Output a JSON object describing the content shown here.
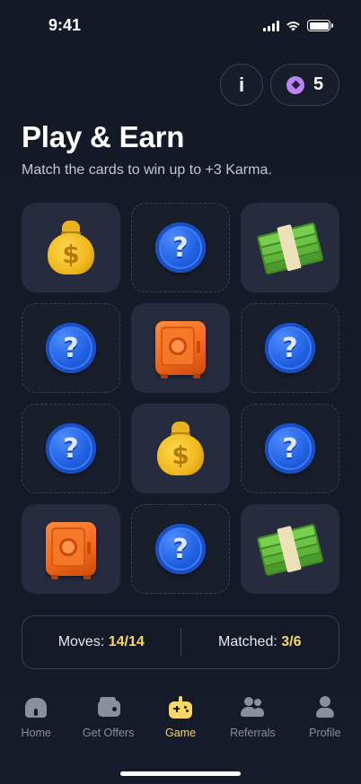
{
  "status_bar": {
    "time": "9:41"
  },
  "header": {
    "info_label": "i",
    "karma_count": "5"
  },
  "title": "Play & Earn",
  "subtitle": "Match the cards to win up to +3 Karma.",
  "grid": {
    "cards": [
      {
        "content": "money-bag",
        "state": "revealed"
      },
      {
        "content": "question-coin",
        "state": "hidden"
      },
      {
        "content": "cash-stack",
        "state": "revealed"
      },
      {
        "content": "question-coin",
        "state": "hidden"
      },
      {
        "content": "safe",
        "state": "revealed"
      },
      {
        "content": "question-coin",
        "state": "hidden"
      },
      {
        "content": "question-coin",
        "state": "hidden"
      },
      {
        "content": "money-bag",
        "state": "revealed"
      },
      {
        "content": "question-coin",
        "state": "hidden"
      },
      {
        "content": "safe",
        "state": "revealed"
      },
      {
        "content": "question-coin",
        "state": "hidden"
      },
      {
        "content": "cash-stack",
        "state": "revealed"
      }
    ]
  },
  "stats": {
    "moves_label": "Moves:",
    "moves_value": "14/14",
    "matched_label": "Matched:",
    "matched_value": "3/6"
  },
  "nav": {
    "items": [
      {
        "label": "Home",
        "icon": "home-icon"
      },
      {
        "label": "Get Offers",
        "icon": "wallet-icon"
      },
      {
        "label": "Game",
        "icon": "gamepad-icon",
        "active": true
      },
      {
        "label": "Referrals",
        "icon": "people-icon"
      },
      {
        "label": "Profile",
        "icon": "profile-icon"
      }
    ]
  },
  "colors": {
    "accent": "#f8d66a",
    "karma": "#b886f2",
    "background": "#131927",
    "card_revealed": "#262b3d",
    "card_hidden": "#191e2b"
  }
}
